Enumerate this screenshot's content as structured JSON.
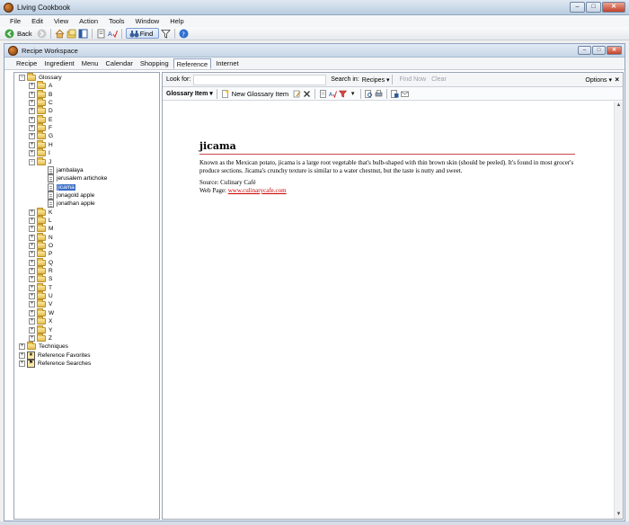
{
  "window": {
    "title": "Living Cookbook"
  },
  "menubar": [
    "File",
    "Edit",
    "View",
    "Action",
    "Tools",
    "Window",
    "Help"
  ],
  "toolbar": {
    "back_label": "Back",
    "find_label": "Find"
  },
  "workspace": {
    "title": "Recipe Workspace",
    "tabs": [
      "Recipe",
      "Ingredient",
      "Menu",
      "Calendar",
      "Shopping",
      "Reference",
      "Internet"
    ],
    "active_tab": "Reference"
  },
  "tree": {
    "root": "Glossary",
    "letters_before": [
      "A",
      "B",
      "C",
      "D",
      "E",
      "F",
      "G",
      "H",
      "I"
    ],
    "open_letter": "J",
    "open_items": [
      "jambalaya",
      "jerusalem artichoke",
      "jicama",
      "jonagold apple",
      "jonathan apple"
    ],
    "selected_item": "jicama",
    "letters_after": [
      "K",
      "L",
      "M",
      "N",
      "O",
      "P",
      "Q",
      "R",
      "S",
      "T",
      "U",
      "V",
      "W",
      "X",
      "Y",
      "Z"
    ],
    "extras": [
      "Techniques",
      "Reference Favorites",
      "Reference Searches"
    ]
  },
  "search": {
    "look_for_label": "Look for:",
    "search_in_label": "Search in:",
    "search_in_value": "Recipes",
    "find_now": "Find Now",
    "clear": "Clear",
    "options": "Options"
  },
  "itembar": {
    "label": "Glossary Item",
    "new_label": "New Glossary Item"
  },
  "entry": {
    "title": "jicama",
    "text": "Known as the Mexican potato, jicama is a large root vegetable that's bulb-shaped with thin brown skin (should be peeled). It's found in most grocer's produce sections. Jicama's crunchy texture is similar to a water chestnut, but the taste is nutty and sweet.",
    "source": "Source: Culinary Café",
    "webpage_label": "Web Page:",
    "webpage_link": "www.culinarycafe.com"
  }
}
